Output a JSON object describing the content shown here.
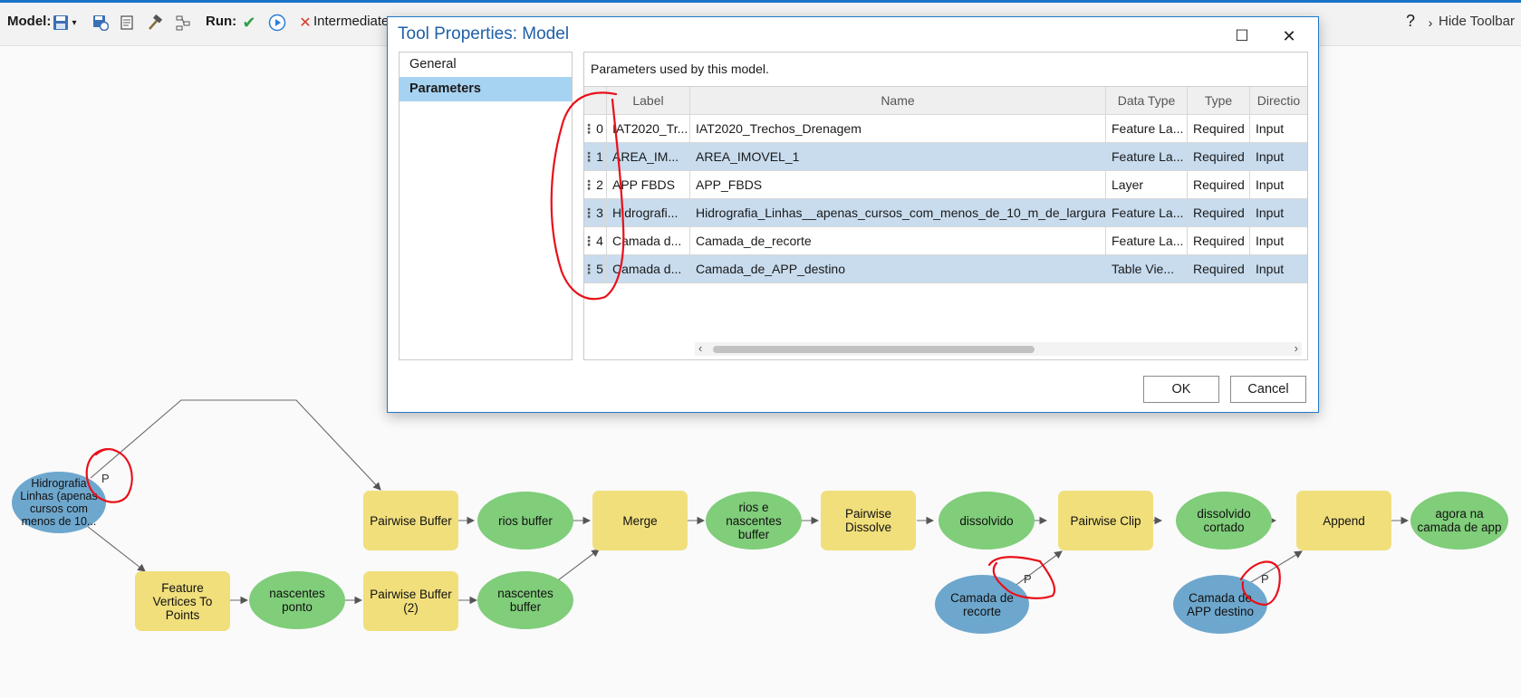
{
  "toolbar": {
    "model_label": "Model:",
    "run_label": "Run:",
    "intermediate_label": "Intermediate",
    "help_icon": "?",
    "hide_toolbar_label": "Hide Toolbar",
    "icons": [
      "save-icon",
      "save-dropdown-icon",
      "save-as-icon",
      "properties-icon",
      "validate-icon",
      "auto-layout-icon",
      "run-validate-check-icon",
      "run-play-icon",
      "delete-intermediate-icon",
      "chevron-right-icon"
    ]
  },
  "dialog": {
    "title": "Tool Properties: Model",
    "nav": [
      "General",
      "Parameters"
    ],
    "active_nav": "Parameters",
    "description": "Parameters used by this model.",
    "columns": [
      "Label",
      "Name",
      "Data Type",
      "Type",
      "Directio"
    ],
    "rows": [
      {
        "index": "0",
        "label": "IAT2020_Tr...",
        "name": "IAT2020_Trechos_Drenagem",
        "data_type": "Feature La...",
        "type": "Required",
        "direction": "Input",
        "selected": false
      },
      {
        "index": "1",
        "label": "AREA_IM...",
        "name": "AREA_IMOVEL_1",
        "data_type": "Feature La...",
        "type": "Required",
        "direction": "Input",
        "selected": true
      },
      {
        "index": "2",
        "label": "APP FBDS",
        "name": "APP_FBDS",
        "data_type": "Layer",
        "type": "Required",
        "direction": "Input",
        "selected": false
      },
      {
        "index": "3",
        "label": "Hidrografi...",
        "name": "Hidrografia_Linhas__apenas_cursos_com_menos_de_10_m_de_largura_",
        "data_type": "Feature La...",
        "type": "Required",
        "direction": "Input",
        "selected": true
      },
      {
        "index": "4",
        "label": "Camada d...",
        "name": "Camada_de_recorte",
        "data_type": "Feature La...",
        "type": "Required",
        "direction": "Input",
        "selected": false
      },
      {
        "index": "5",
        "label": "Camada d...",
        "name": "Camada_de_APP_destino",
        "data_type": "Table Vie...",
        "type": "Required",
        "direction": "Input",
        "selected": true
      }
    ],
    "ok_label": "OK",
    "cancel_label": "Cancel",
    "maximize_icon": "☐",
    "close_icon": "✕"
  },
  "model": {
    "nodes": {
      "hidro": "Hidrografia Linhas (apenas cursos com menos de 10...",
      "pb1": "Pairwise Buffer",
      "rios_buffer": "rios buffer",
      "merge": "Merge",
      "rios_nasc": "rios e nascentes buffer",
      "dissolve": "Pairwise Dissolve",
      "dissolvido": "dissolvido",
      "clip": "Pairwise Clip",
      "dissolvido_cortado": "dissolvido cortado",
      "append": "Append",
      "agora": "agora na camada de app",
      "fvtp": "Feature Vertices To Points",
      "nascentes_ponto": "nascentes ponto",
      "pb2": "Pairwise Buffer (2)",
      "nascentes_buffer": "nascentes buffer",
      "camada_recorte": "Camada de recorte",
      "camada_app": "Camada de APP destino"
    },
    "param_marker": "P"
  },
  "annotation_color": "#e8101a"
}
